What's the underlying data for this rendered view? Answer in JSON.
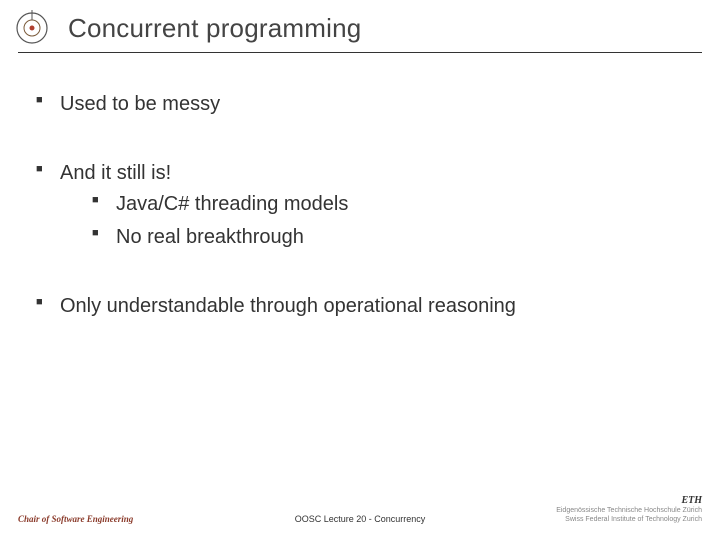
{
  "title": "Concurrent programming",
  "bullets": [
    {
      "text": "Used to be messy",
      "sub": []
    },
    {
      "text": "And it still is!",
      "sub": [
        {
          "text": "Java/C# threading models"
        },
        {
          "text": "No real breakthrough"
        }
      ]
    },
    {
      "text": "Only understandable through operational reasoning",
      "sub": []
    }
  ],
  "footer": {
    "left": "Chair of Software Engineering",
    "center": "OOSC  Lecture 20 - Concurrency",
    "right_name": "ETH",
    "right_sub1": "Eidgenössische Technische Hochschule Zürich",
    "right_sub2": "Swiss Federal Institute of Technology Zurich"
  },
  "colors": {
    "rule": "#333333",
    "accent": "#8a3a2a"
  }
}
